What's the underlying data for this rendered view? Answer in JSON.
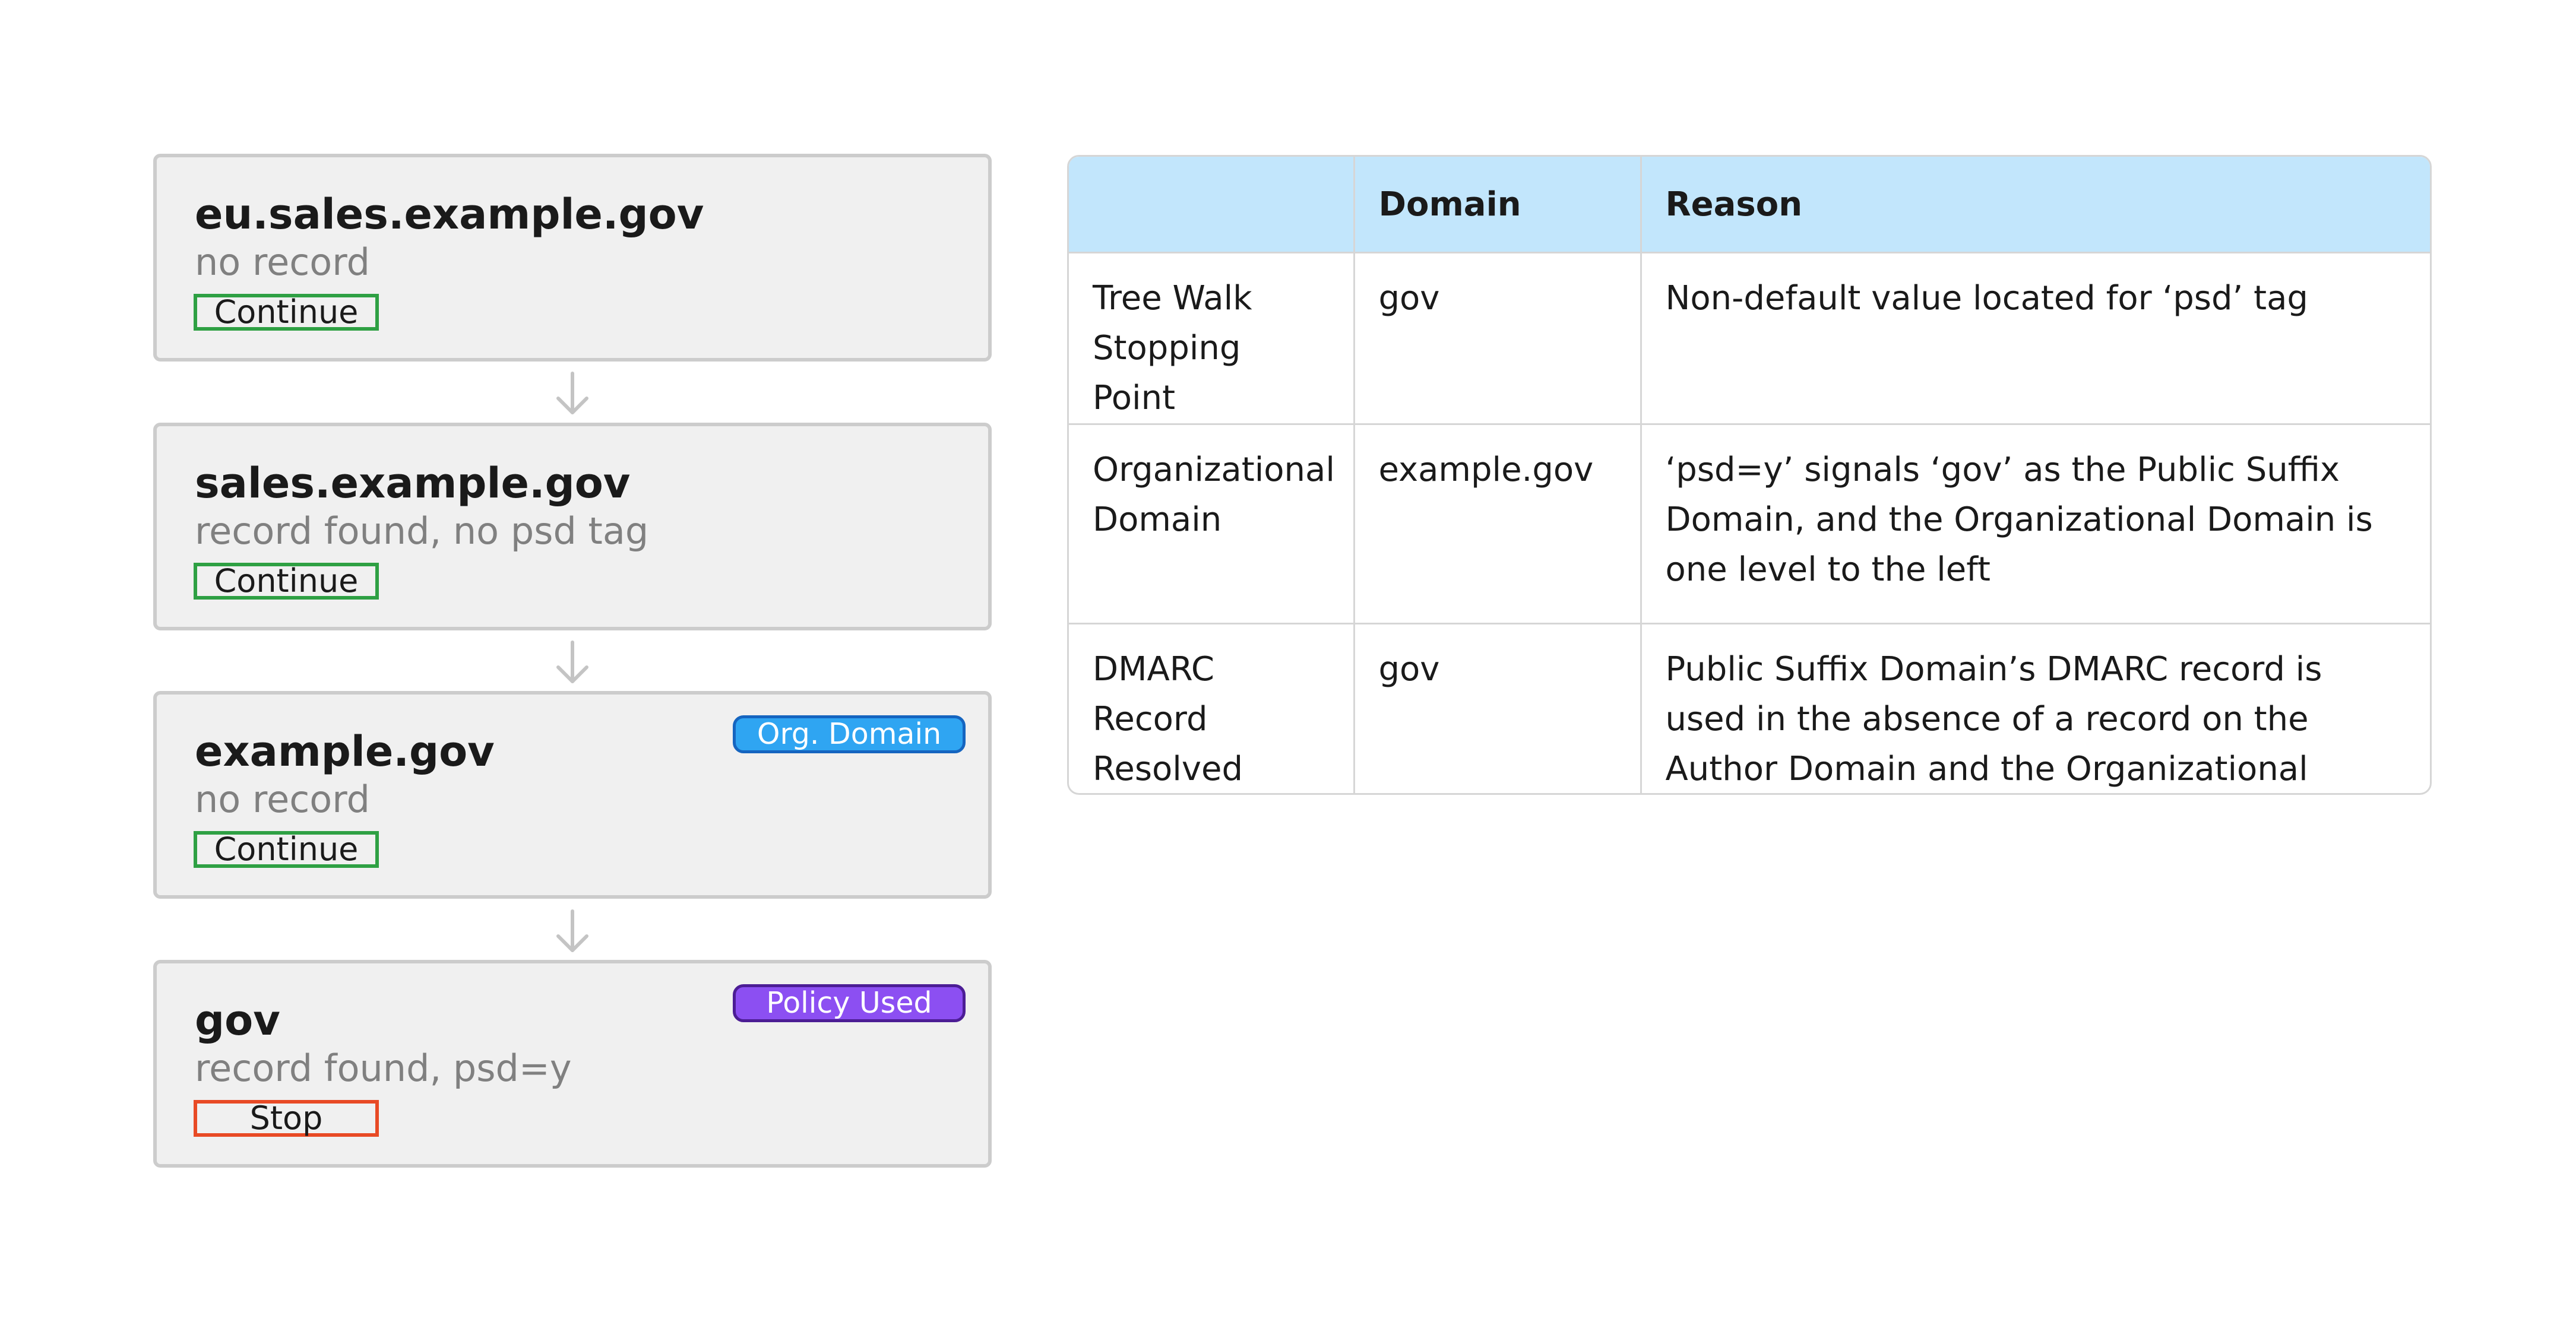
{
  "flow": {
    "steps": [
      {
        "title": "eu.sales.example.gov",
        "status": "no record",
        "action": "Continue",
        "badge": ""
      },
      {
        "title": "sales.example.gov",
        "status": "record found, no psd tag",
        "action": "Continue",
        "badge": ""
      },
      {
        "title": "example.gov",
        "status": "no record",
        "action": "Continue",
        "badge": "Org. Domain"
      },
      {
        "title": "gov",
        "status": "record found, psd=y",
        "action": "Stop",
        "badge": "Policy Used"
      }
    ]
  },
  "table": {
    "headers": [
      "",
      "Domain",
      "Reason"
    ],
    "rows": [
      {
        "label": "Tree Walk Stopping Point",
        "domain": "gov",
        "reason": "Non-default value located for ‘psd’ tag"
      },
      {
        "label": "Organizational Domain",
        "domain": "example.gov",
        "reason": "‘psd=y’ signals ‘gov’ as the Public Suffix Domain, and the Organizational Domain is one level to the left"
      },
      {
        "label": "DMARC Record Resolved From",
        "domain": "gov",
        "reason": "Public Suffix Domain’s DMARC record is used in the absence of a record on the Author Domain and the Organizational Domain"
      }
    ]
  },
  "colors": {
    "continue_border": "#2ea043",
    "stop_border": "#e84a25",
    "org_domain_badge": "#2fa5f2",
    "policy_used_badge": "#8c4ff2",
    "table_header_bg": "#c2e6fc",
    "box_bg": "#f0f0f0"
  },
  "icons": {
    "connector": "arrow-down-icon"
  }
}
